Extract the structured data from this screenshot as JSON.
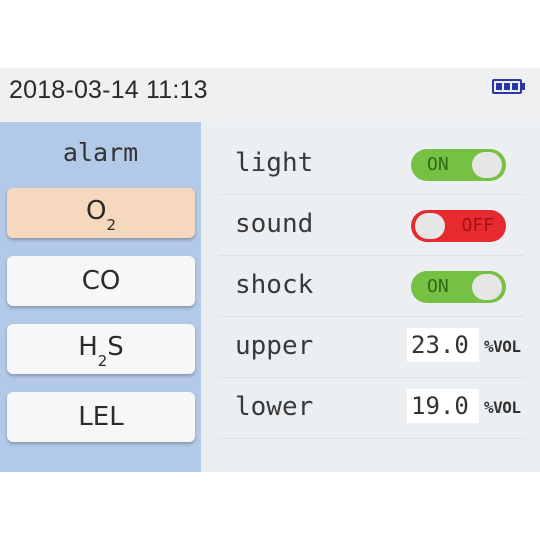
{
  "status_bar": {
    "datetime": "2018-03-14 11:13",
    "battery_icon": "battery-full-icon",
    "battery_color": "#2b36a8"
  },
  "sidebar": {
    "title": "alarm",
    "items": [
      {
        "main": "O",
        "sub": "2",
        "active": true
      },
      {
        "main": "CO",
        "sub": "",
        "active": false
      },
      {
        "main": "H",
        "sub": "2",
        "tail": "S",
        "active": false
      },
      {
        "main": "LEL",
        "sub": "",
        "active": false
      }
    ]
  },
  "settings": {
    "light": {
      "label": "light",
      "state": "ON"
    },
    "sound": {
      "label": "sound",
      "state": "OFF"
    },
    "shock": {
      "label": "shock",
      "state": "ON"
    },
    "upper": {
      "label": "upper",
      "value": "23.0",
      "unit": "%VOL"
    },
    "lower": {
      "label": "lower",
      "value": "19.0",
      "unit": "%VOL"
    }
  },
  "colors": {
    "toggle_on": "#76c043",
    "toggle_off": "#e62a2f",
    "sidebar_bg": "#b3c9e8",
    "active_item_bg": "#f6d8bf"
  }
}
